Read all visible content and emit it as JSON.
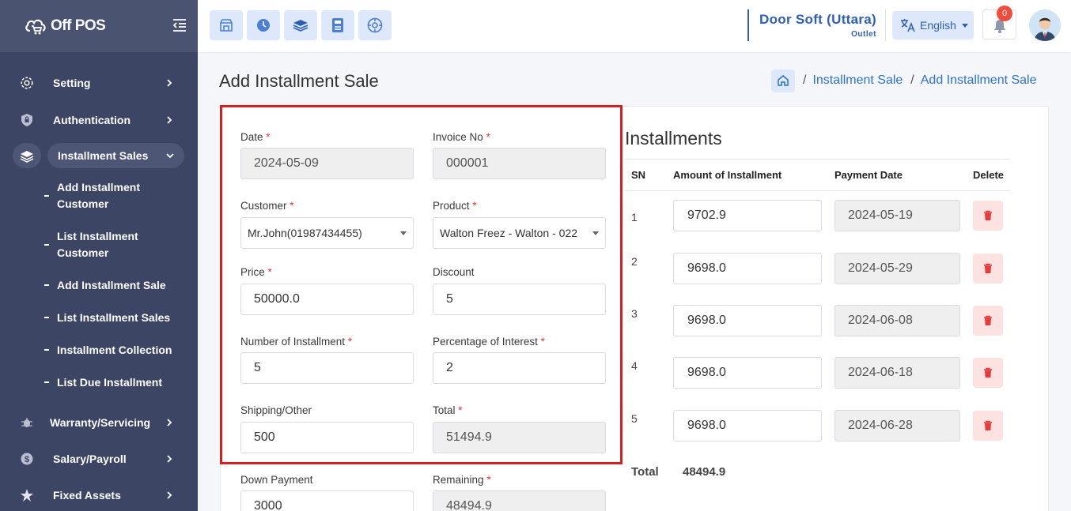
{
  "brand": {
    "name": "Off POS"
  },
  "sidebar": {
    "items": [
      {
        "label": "Setting",
        "icon": "gear-icon"
      },
      {
        "label": "Authentication",
        "icon": "shield-icon"
      },
      {
        "label": "Installment Sales",
        "icon": "layers-icon",
        "expanded": true
      },
      {
        "label": "Warranty/Servicing",
        "icon": "bug-icon"
      },
      {
        "label": "Salary/Payroll",
        "icon": "dollar-icon"
      },
      {
        "label": "Fixed Assets",
        "icon": "star-icon"
      }
    ],
    "submenu": [
      {
        "label": "Add Installment Customer"
      },
      {
        "label": "List Installment Customer"
      },
      {
        "label": "Add Installment Sale"
      },
      {
        "label": "List Installment Sales"
      },
      {
        "label": "Installment Collection"
      },
      {
        "label": "List Due Installment"
      }
    ]
  },
  "topbar": {
    "outlet_name": "Door Soft (Uttara)",
    "outlet_type": "Outlet",
    "language": "English",
    "notification_count": "0",
    "quick_buttons": [
      "store-icon",
      "clock-icon",
      "layers-icon",
      "calculator-icon",
      "dashboard-icon"
    ]
  },
  "page": {
    "title": "Add Installment Sale",
    "breadcrumb": [
      "Installment Sale",
      "Add Installment Sale"
    ]
  },
  "form": {
    "date": {
      "label": "Date",
      "value": "2024-05-09"
    },
    "invoice_no": {
      "label": "Invoice No",
      "value": "000001"
    },
    "customer": {
      "label": "Customer",
      "value": "Mr.John(01987434455)"
    },
    "product": {
      "label": "Product",
      "value": "Walton Freez - Walton - 022"
    },
    "price": {
      "label": "Price",
      "value": "50000.0"
    },
    "discount": {
      "label": "Discount",
      "value": "5"
    },
    "num_installment": {
      "label": "Number of Installment",
      "value": "5"
    },
    "interest": {
      "label": "Percentage of Interest",
      "value": "2"
    },
    "shipping": {
      "label": "Shipping/Other",
      "value": "500"
    },
    "total": {
      "label": "Total",
      "value": "51494.9"
    },
    "down_payment": {
      "label": "Down Payment",
      "value": "3000"
    },
    "remaining": {
      "label": "Remaining",
      "value": "48494.9"
    }
  },
  "installments": {
    "title": "Installments",
    "headers": {
      "sn": "SN",
      "amount": "Amount of Installment",
      "date": "Payment Date",
      "delete": "Delete"
    },
    "rows": [
      {
        "sn": "1",
        "amount": "9702.9",
        "date": "2024-05-19"
      },
      {
        "sn": "2",
        "amount": "9698.0",
        "date": "2024-05-29"
      },
      {
        "sn": "3",
        "amount": "9698.0",
        "date": "2024-06-08"
      },
      {
        "sn": "4",
        "amount": "9698.0",
        "date": "2024-06-18"
      },
      {
        "sn": "5",
        "amount": "9698.0",
        "date": "2024-06-28"
      }
    ],
    "total_label": "Total",
    "total_value": "48494.9"
  },
  "colors": {
    "sidebar": "#3c4563",
    "accent": "#2d5fb4",
    "highlight": "#d81f1f",
    "danger": "#ef4c3c"
  }
}
